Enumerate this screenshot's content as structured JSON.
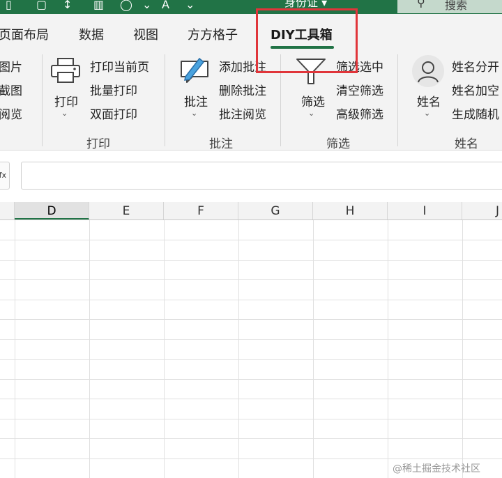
{
  "titlebar": {
    "doc_title": "身份证 ▾",
    "search_label": "搜索",
    "icons": [
      "format-painter-icon",
      "clipboard-icon",
      "sort-az-icon",
      "chart-icon",
      "shapes-icon",
      "font-color-icon"
    ]
  },
  "tabs": [
    {
      "label": "页面布局"
    },
    {
      "label": "数据"
    },
    {
      "label": "视图"
    },
    {
      "label": "方方格子"
    },
    {
      "label": "DIY工具箱",
      "active": true
    }
  ],
  "ribbon": {
    "left_partial": [
      "图片",
      "截图",
      "阅览"
    ],
    "print_group": {
      "big_label": "打印",
      "items": [
        "打印当前页",
        "批量打印",
        "双面打印"
      ],
      "group_label": "打印"
    },
    "comment_group": {
      "big_label": "批注",
      "items": [
        "添加批注",
        "删除批注",
        "批注阅览"
      ],
      "group_label": "批注"
    },
    "filter_group": {
      "big_label": "筛选",
      "items": [
        "筛选选中",
        "清空筛选",
        "高级筛选"
      ],
      "group_label": "筛选"
    },
    "name_group": {
      "big_label": "姓名",
      "items": [
        "姓名分开",
        "姓名加空",
        "生成随机"
      ],
      "group_label": "姓名"
    }
  },
  "formula_bar": {
    "fx_label": "fx",
    "value": ""
  },
  "columns": [
    {
      "label": "D",
      "selected": true
    },
    {
      "label": "E"
    },
    {
      "label": "F"
    },
    {
      "label": "G"
    },
    {
      "label": "H"
    },
    {
      "label": "I"
    },
    {
      "label": "J"
    }
  ],
  "watermark": "@稀土掘金技术社区",
  "colors": {
    "accent": "#217346",
    "highlight": "#e0353a",
    "ribbon_bg": "#f3f3f3"
  }
}
